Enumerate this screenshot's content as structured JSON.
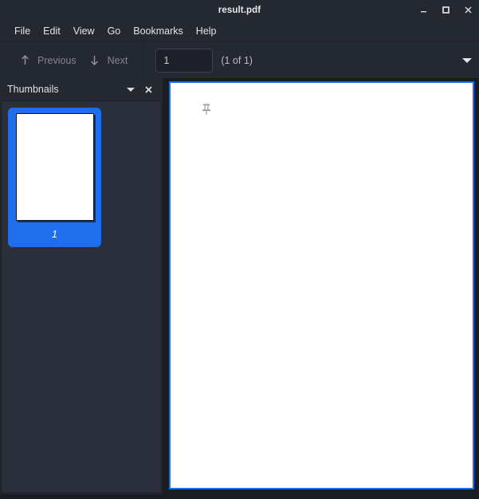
{
  "window": {
    "title": "result.pdf",
    "controls": [
      {
        "name": "minimize-button",
        "glyph": "minimize"
      },
      {
        "name": "maximize-button",
        "glyph": "maximize"
      },
      {
        "name": "close-button",
        "glyph": "close"
      }
    ]
  },
  "menubar": {
    "items": [
      {
        "label": "File"
      },
      {
        "label": "Edit"
      },
      {
        "label": "View"
      },
      {
        "label": "Go"
      },
      {
        "label": "Bookmarks"
      },
      {
        "label": "Help"
      }
    ]
  },
  "toolbar": {
    "previous_label": "Previous",
    "previous_icon": "arrow-up-icon",
    "next_label": "Next",
    "next_icon": "arrow-down-icon",
    "page_number_value": "1",
    "page_number_placeholder": "",
    "page_count_label": "(1 of 1)",
    "overflow_icon": "chevron-down-icon"
  },
  "sidebar": {
    "title": "Thumbnails",
    "dropdown_icon": "chevron-down-icon",
    "close_icon": "close-icon",
    "thumbnails": [
      {
        "label": "1",
        "selected": true
      }
    ]
  },
  "document": {
    "page_icon": "pushpin-icon",
    "background_color": "#ffffff",
    "border_color": "#1f6fed"
  },
  "colors": {
    "chrome": "#242831",
    "panel": "#2b2e3b",
    "canvas": "#1a1c24",
    "accent": "#1f6fed",
    "text": "#e2e4ea",
    "text_disabled": "#83868f"
  }
}
